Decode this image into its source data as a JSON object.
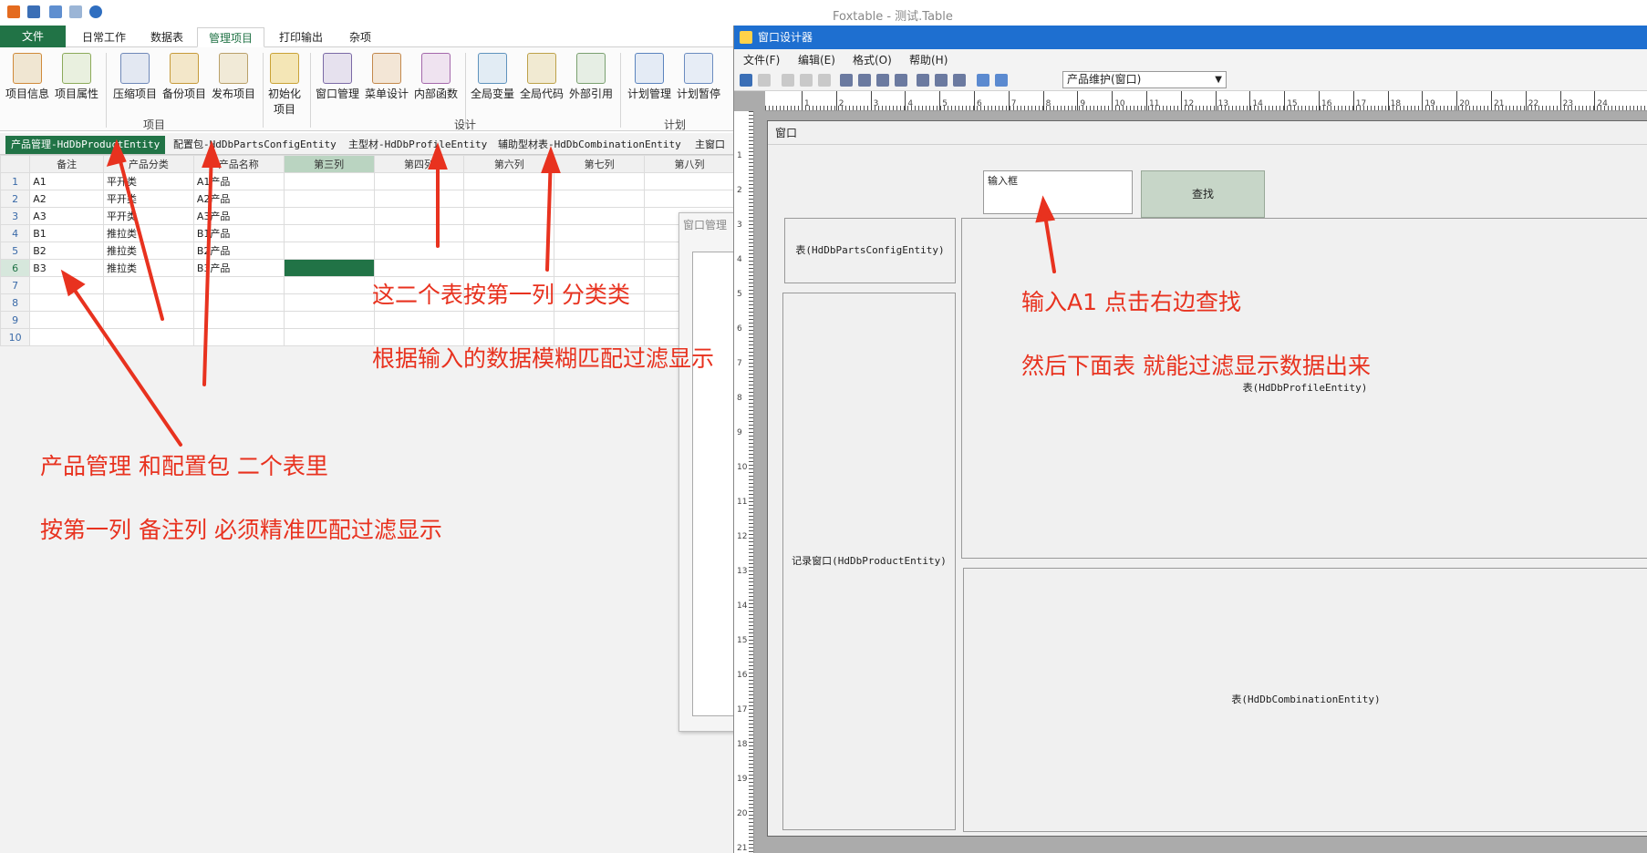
{
  "app": {
    "title": "Foxtable - 测试.Table"
  },
  "ribbon": {
    "tabs": [
      "文件",
      "日常工作",
      "数据表",
      "管理项目",
      "打印输出",
      "杂项"
    ],
    "buttons": [
      "项目信息",
      "项目属性",
      "压缩项目",
      "备份项目",
      "发布项目",
      "初始化项目",
      "窗口管理",
      "菜单设计",
      "内部函数",
      "全局变量",
      "全局代码",
      "外部引用",
      "计划管理",
      "计划暂停"
    ],
    "groups": [
      "项目",
      "设计",
      "计划"
    ]
  },
  "doc_tabs": [
    "产品管理-HdDbProductEntity",
    "配置包-HdDbPartsConfigEntity",
    "主型材-HdDbProfileEntity",
    "辅助型材表-HdDbCombinationEntity",
    "主窗口"
  ],
  "grid": {
    "columns": [
      "备注",
      "产品分类",
      "产品名称",
      "第三列",
      "第四列",
      "第六列",
      "第七列",
      "第八列"
    ],
    "rows": [
      {
        "n": "1",
        "c": [
          "A1",
          "平开类",
          "A1产品"
        ]
      },
      {
        "n": "2",
        "c": [
          "A2",
          "平开类",
          "A2产品"
        ]
      },
      {
        "n": "3",
        "c": [
          "A3",
          "平开类",
          "A3产品"
        ]
      },
      {
        "n": "4",
        "c": [
          "B1",
          "推拉类",
          "B1产品"
        ]
      },
      {
        "n": "5",
        "c": [
          "B2",
          "推拉类",
          "B2产品"
        ]
      },
      {
        "n": "6",
        "c": [
          "B3",
          "推拉类",
          "B3产品"
        ]
      },
      {
        "n": "7",
        "c": [
          "",
          "",
          ""
        ]
      },
      {
        "n": "8",
        "c": [
          "",
          "",
          ""
        ]
      },
      {
        "n": "9",
        "c": [
          "",
          "",
          ""
        ]
      },
      {
        "n": "10",
        "c": [
          "",
          "",
          ""
        ]
      }
    ]
  },
  "window_manager": {
    "title": "窗口管理"
  },
  "designer": {
    "title": "窗口设计器",
    "menu": [
      "文件(F)",
      "编辑(E)",
      "格式(O)",
      "帮助(H)"
    ],
    "combo_value": "产品维护(窗口)",
    "ruler_h": [
      "1",
      "2",
      "3",
      "4",
      "5",
      "6",
      "7",
      "8",
      "9",
      "10",
      "11",
      "12",
      "13",
      "14",
      "15",
      "16",
      "17",
      "18",
      "19",
      "20",
      "21",
      "22",
      "23",
      "24"
    ],
    "ruler_v": [
      "1",
      "2",
      "3",
      "4",
      "5",
      "6",
      "7",
      "8",
      "9",
      "10",
      "11",
      "12",
      "13",
      "14",
      "15",
      "16",
      "17",
      "18",
      "19",
      "20",
      "21"
    ],
    "form_caption": "窗口",
    "input_label": "输入框",
    "search_button": "查找",
    "table_parts": "表(HdDbPartsConfigEntity)",
    "record_window": "记录窗口(HdDbProductEntity)",
    "table_profile": "表(HdDbProfileEntity)",
    "table_combination": "表(HdDbCombinationEntity)"
  },
  "annotations": {
    "n1": "这二个表按第一列  分类类",
    "n2": "根据输入的数据模糊匹配过滤显示",
    "n3": "输入A1 点击右边查找",
    "n4": "然后下面表  就能过滤显示数据出来",
    "n5": "产品管理 和配置包  二个表里",
    "n6": "按第一列   备注列   必须精准匹配过滤显示"
  },
  "colors": {
    "accent": "#217346",
    "annotation": "#e8321f",
    "designer_title": "#1e6fd0"
  }
}
